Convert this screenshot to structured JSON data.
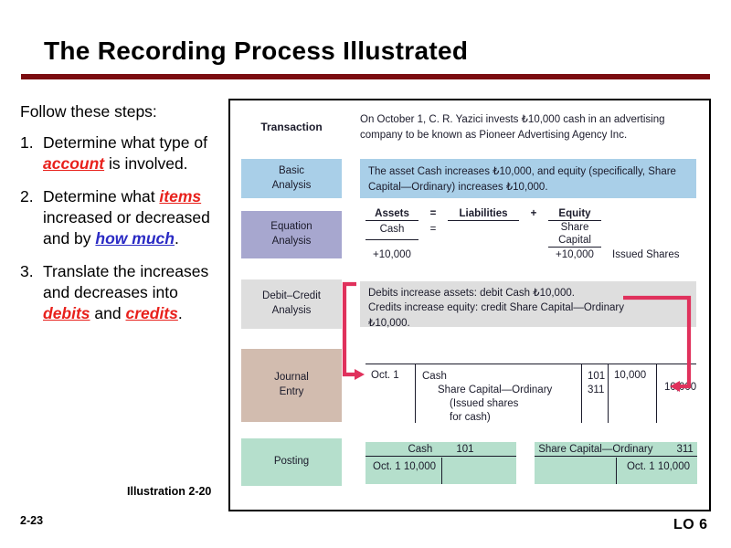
{
  "slide": {
    "title": "The Recording Process Illustrated",
    "slide_number": "2-23",
    "lo_label": "LO 6",
    "illustration_ref": "Illustration 2-20",
    "accent_color": "#7B0C10"
  },
  "left": {
    "intro": "Follow these steps:",
    "steps": [
      {
        "num": "1.",
        "parts": [
          {
            "text": "Determine what type of ",
            "style": "plain"
          },
          {
            "text": "account",
            "style": "red"
          },
          {
            "text": " is involved.",
            "style": "plain"
          }
        ]
      },
      {
        "num": "2.",
        "parts": [
          {
            "text": "Determine what ",
            "style": "plain"
          },
          {
            "text": "items",
            "style": "red"
          },
          {
            "text": " increased or decreased and by ",
            "style": "plain"
          },
          {
            "text": "how much",
            "style": "blue"
          },
          {
            "text": ".",
            "style": "plain"
          }
        ]
      },
      {
        "num": "3.",
        "parts": [
          {
            "text": "Translate the increases and decreases into ",
            "style": "plain"
          },
          {
            "text": "debits",
            "style": "red"
          },
          {
            "text": " and ",
            "style": "plain"
          },
          {
            "text": "credits",
            "style": "red"
          },
          {
            "text": ".",
            "style": "plain"
          }
        ]
      }
    ],
    "highlight_red": "#E8211C",
    "highlight_blue": "#2A2AC4"
  },
  "illustration": {
    "transaction": {
      "label": "Transaction",
      "text": "On October 1, C. R. Yazici invests ₺10,000 cash in an advertising company to be known as Pioneer Advertising Agency Inc."
    },
    "basic_analysis": {
      "label_line1": "Basic",
      "label_line2": "Analysis",
      "color": "#A9CFE8",
      "text": "The asset Cash increases ₺10,000, and equity (specifically, Share Capital—Ordinary) increases ₺10,000."
    },
    "equation_analysis": {
      "label_line1": "Equation",
      "label_line2": "Analysis",
      "color": "#A7A7CF",
      "headers": {
        "assets": "Assets",
        "equals": "=",
        "liabilities": "Liabilities",
        "plus": "+",
        "equity": "Equity"
      },
      "rows": {
        "assets_account": "Cash",
        "equals_mid": "=",
        "equity_account_line1": "Share",
        "equity_account_line2": "Capital",
        "assets_amount": "+10,000",
        "equity_amount": "+10,000",
        "note": "Issued Shares"
      }
    },
    "debit_credit_analysis": {
      "label_line1": "Debit–Credit",
      "label_line2": "Analysis",
      "color": "#DEDEDE",
      "line1": "Debits increase assets: debit Cash ₺10,000.",
      "line2": "Credits increase equity: credit Share Capital—Ordinary",
      "line3": "₺10,000."
    },
    "journal_entry": {
      "label_line1": "Journal",
      "label_line2": "Entry",
      "color": "#D2BCAF",
      "date": "Oct. 1",
      "account_debit": "Cash",
      "account_credit": "Share Capital—Ordinary",
      "explanation_line1": "(Issued shares",
      "explanation_line2": "for cash)",
      "ref_debit": "101",
      "ref_credit": "311",
      "amount_debit": "10,000",
      "amount_credit": "10,000"
    },
    "posting": {
      "label": "Posting",
      "color": "#B5DFCC",
      "accounts": [
        {
          "name": "Cash",
          "number": "101",
          "debit_entry": "Oct. 1 10,000",
          "credit_entry": ""
        },
        {
          "name": "Share Capital—Ordinary",
          "number": "311",
          "debit_entry": "",
          "credit_entry": "Oct. 1 10,000"
        }
      ]
    },
    "arrow_color": "#E0315C"
  }
}
